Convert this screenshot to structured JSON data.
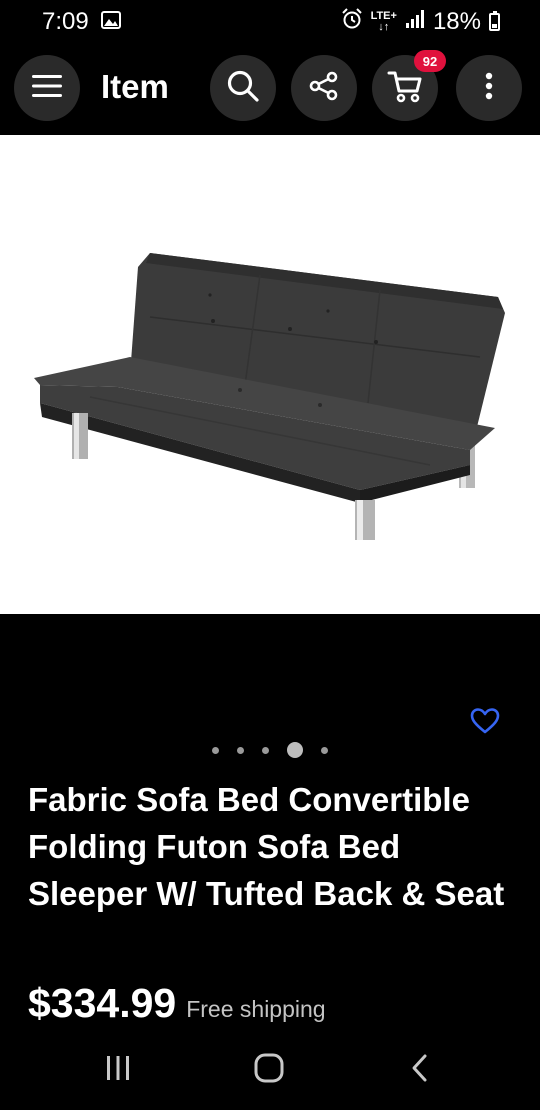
{
  "status_bar": {
    "time": "7:09",
    "network_label": "LTE+",
    "network_arrows": "↓↑",
    "battery_percent": "18%",
    "icons": [
      "image-notification-icon",
      "alarm-icon",
      "signal-icon",
      "battery-icon"
    ]
  },
  "app_bar": {
    "title": "Item",
    "cart_count": "92",
    "icons": [
      "hamburger-menu-icon",
      "search-icon",
      "share-icon",
      "cart-icon",
      "more-vert-icon"
    ]
  },
  "gallery": {
    "image_subject": "dark gray fabric futon sofa bed with chrome legs",
    "dot_count": 5,
    "active_dot": 4
  },
  "product": {
    "title": "Fabric Sofa Bed Convertible Folding Futon Sofa Bed Sleeper W/ Tufted Back & Seat",
    "price": "$334.99",
    "shipping": "Free shipping"
  },
  "colors": {
    "badge": "#e0113d",
    "heart": "#3665f3",
    "background": "#000000",
    "button_bg": "#2a2a2a"
  },
  "nav_bar": {
    "icons": [
      "recent-apps-icon",
      "home-icon",
      "back-icon"
    ]
  }
}
